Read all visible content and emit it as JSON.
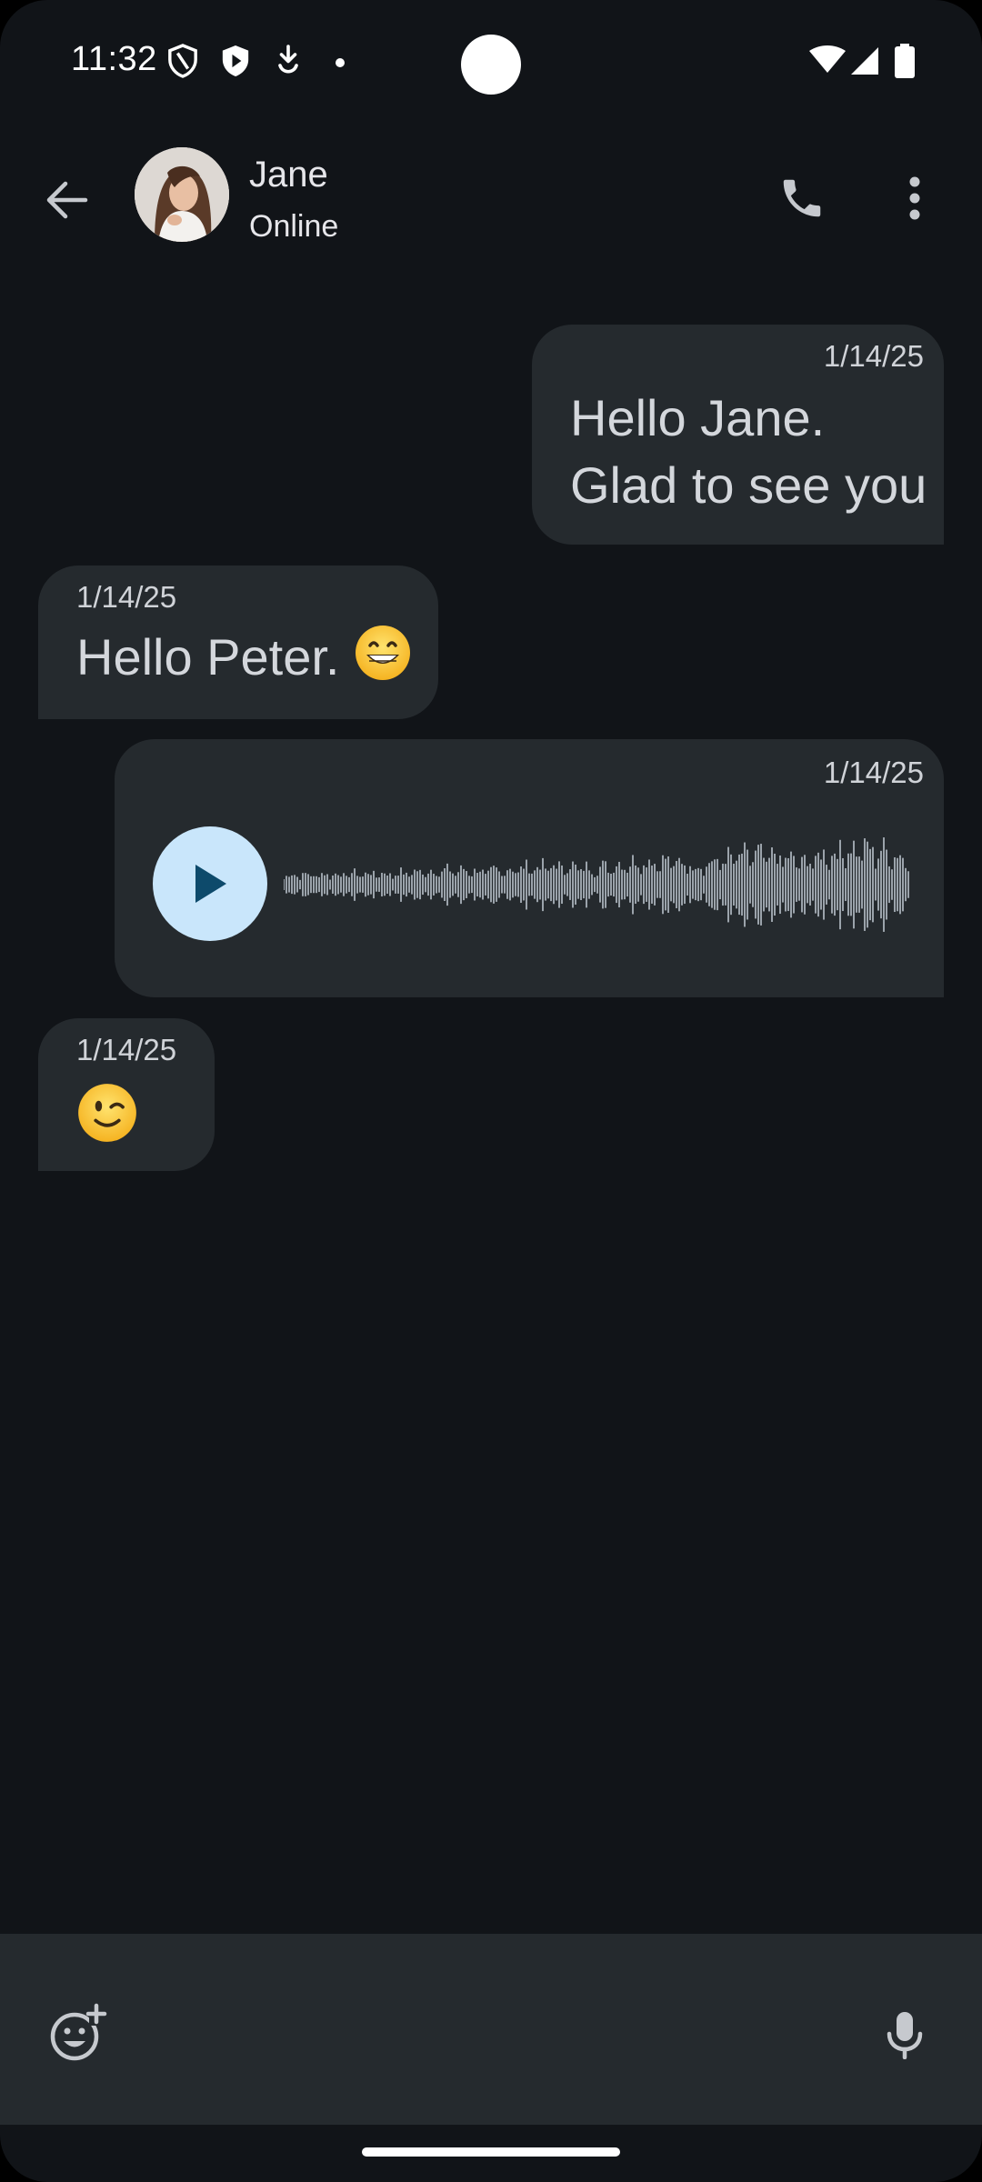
{
  "status_bar": {
    "time": "11:32",
    "icons": [
      "shield-outline-icon",
      "shield-play-icon",
      "download-icon",
      "dot-icon",
      "wifi-icon",
      "signal-icon",
      "battery-icon"
    ]
  },
  "header": {
    "contact_name": "Jane",
    "contact_status": "Online",
    "icons": [
      "back-arrow-icon",
      "avatar",
      "phone-icon",
      "more-vert-icon"
    ]
  },
  "messages": [
    {
      "direction": "outgoing",
      "timestamp": "1/14/25",
      "line1": "Hello Jane.",
      "line2": "Glad to see you"
    },
    {
      "direction": "incoming",
      "timestamp": "1/14/25",
      "text": "Hello Peter.",
      "emoji": "grinning-face-with-smiling-eyes"
    },
    {
      "direction": "outgoing",
      "timestamp": "1/14/25",
      "type": "voice",
      "icon": "play-icon"
    },
    {
      "direction": "incoming",
      "timestamp": "1/14/25",
      "emoji": "winking-face"
    }
  ],
  "composer": {
    "placeholder": "",
    "icons": [
      "add-emoji-icon",
      "mic-icon"
    ]
  },
  "colors": {
    "background": "#111418",
    "bubble": "#252a2e",
    "play_button": "#c9e6fb",
    "play_icon": "#0d4a6b",
    "waveform": "#9ba3ab"
  }
}
